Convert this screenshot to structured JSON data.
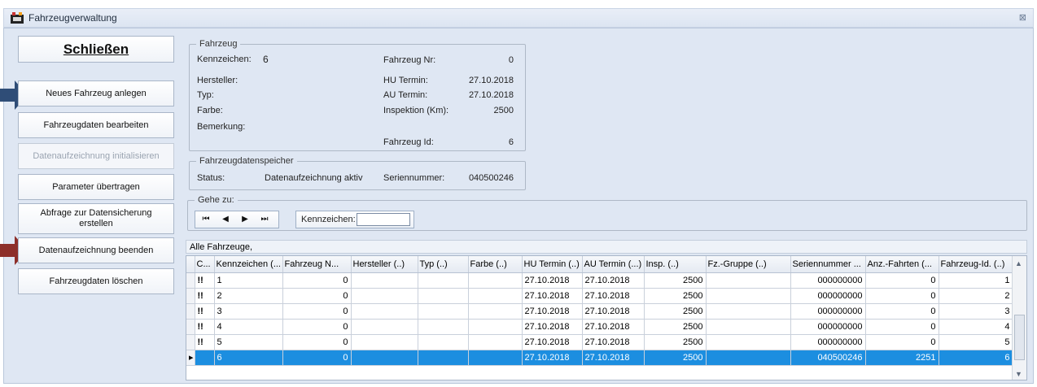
{
  "window": {
    "title": "Fahrzeugverwaltung",
    "close_label": "⊠"
  },
  "sidebar": {
    "close_button": "Schließen",
    "new_vehicle": "Neues Fahrzeug anlegen",
    "edit_vehicle": "Fahrzeugdaten bearbeiten",
    "init_recording": "Datenaufzeichnung initialisieren",
    "transfer_params": "Parameter übertragen",
    "backup_query": "Abfrage zur Datensicherung erstellen",
    "end_recording": "Datenaufzeichnung beenden",
    "delete_vehicle": "Fahrzeugdaten löschen"
  },
  "vehicle": {
    "legend": "Fahrzeug",
    "plate_label": "Kennzeichen:",
    "plate_value": "6",
    "manufacturer_label": "Hersteller:",
    "type_label": "Typ:",
    "color_label": "Farbe:",
    "remark_label": "Bemerkung:",
    "number_label": "Fahrzeug Nr:",
    "number_value": "0",
    "hu_label": "HU Termin:",
    "hu_value": "27.10.2018",
    "au_label": "AU Termin:",
    "au_value": "27.10.2018",
    "inspection_label": "Inspektion (Km):",
    "inspection_value": "2500",
    "id_label": "Fahrzeug Id:",
    "id_value": "6"
  },
  "storage": {
    "legend": "Fahrzeugdatenspeicher",
    "status_label": "Status:",
    "status_value": "Datenaufzeichnung aktiv",
    "serial_label": "Seriennummer:",
    "serial_value": "040500246"
  },
  "goto": {
    "legend": "Gehe zu:",
    "first": "⏮",
    "prev": "◀",
    "next": "▶",
    "last": "⏭",
    "plate_label": "Kennzeichen:",
    "plate_input": ""
  },
  "grid": {
    "caption": "Alle Fahrzeuge,",
    "columns": [
      "C...",
      "Kennzeichen (...",
      "Fahrzeug N...",
      "Hersteller (..)",
      "Typ (..)",
      "Farbe (..)",
      "HU Termin (..)",
      "AU Termin (...)",
      "Insp. (..)",
      "Fz.-Gruppe (..)",
      "Seriennummer ...",
      "Anz.-Fahrten (...",
      "Fahrzeug-Id. (..)"
    ],
    "rows": [
      [
        "!!",
        "1",
        "0",
        "",
        "",
        "",
        "27.10.2018",
        "27.10.2018",
        "2500",
        "",
        "000000000",
        "0",
        "1"
      ],
      [
        "!!",
        "2",
        "0",
        "",
        "",
        "",
        "27.10.2018",
        "27.10.2018",
        "2500",
        "",
        "000000000",
        "0",
        "2"
      ],
      [
        "!!",
        "3",
        "0",
        "",
        "",
        "",
        "27.10.2018",
        "27.10.2018",
        "2500",
        "",
        "000000000",
        "0",
        "3"
      ],
      [
        "!!",
        "4",
        "0",
        "",
        "",
        "",
        "27.10.2018",
        "27.10.2018",
        "2500",
        "",
        "000000000",
        "0",
        "4"
      ],
      [
        "!!",
        "5",
        "0",
        "",
        "",
        "",
        "27.10.2018",
        "27.10.2018",
        "2500",
        "",
        "000000000",
        "0",
        "5"
      ],
      [
        "",
        "6",
        "0",
        "",
        "",
        "",
        "27.10.2018",
        "27.10.2018",
        "2500",
        "",
        "040500246",
        "2251",
        "6"
      ]
    ],
    "selected_row": 5
  },
  "colors": {
    "selection": "#1c8ee0",
    "arrow": "#2f4d77",
    "arrow_red": "#8d2f2a"
  },
  "icons": {
    "app": "film-reel-icon",
    "arrow_blue": "arrow-right-icon",
    "arrow_red": "arrow-right-icon"
  }
}
